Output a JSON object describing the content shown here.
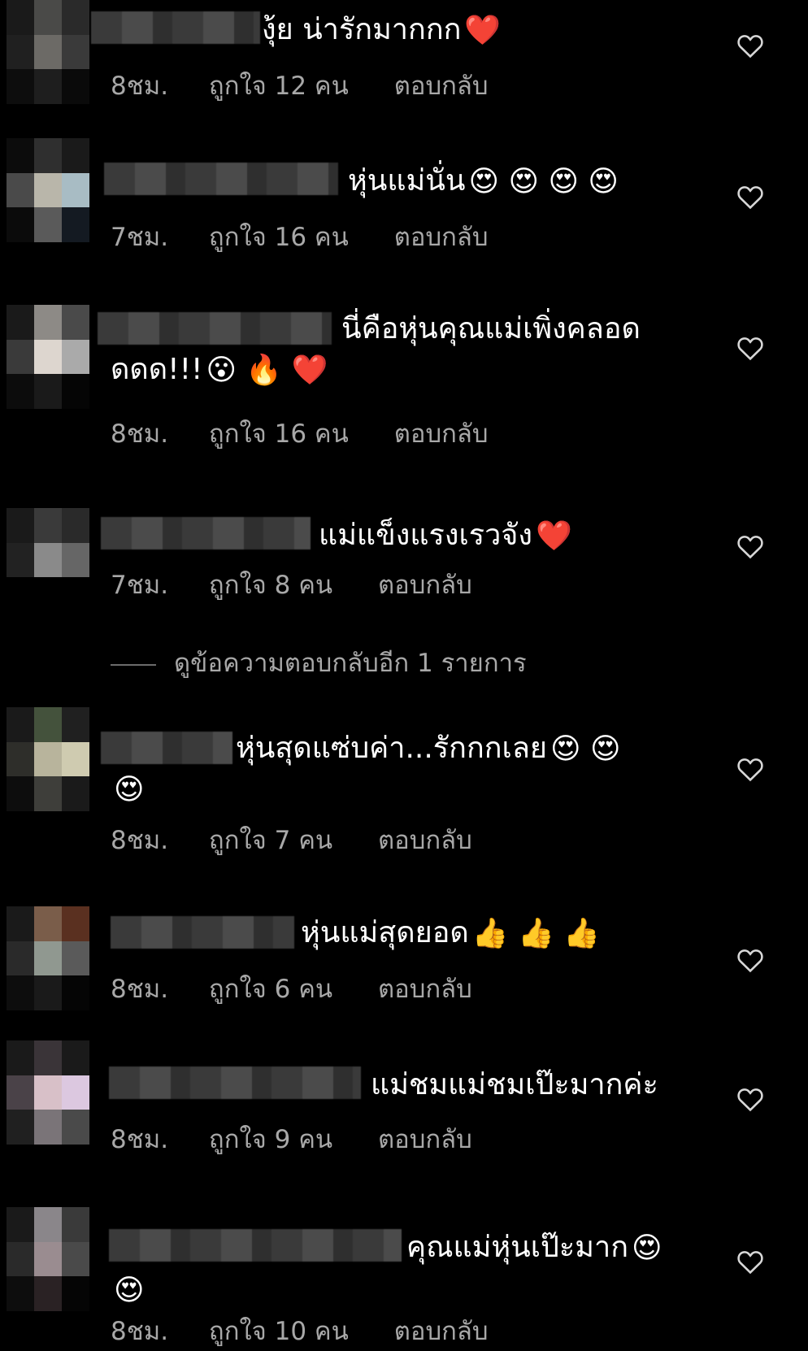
{
  "comments": [
    {
      "text": "งุ้ย น่ารักมากกก",
      "emoji": "❤️",
      "time": "8ชม.",
      "likes": "ถูกใจ 12 คน",
      "reply": "ตอบกลับ"
    },
    {
      "text": "หุ่นแม่นั่น",
      "emoji": "😍 😍 😍 😍",
      "time": "7ชม.",
      "likes": "ถูกใจ 16 คน",
      "reply": "ตอบกลับ"
    },
    {
      "text": "นี่คือหุ่นคุณแม่เพิ่งคลอด",
      "text2": "ดดด!!!",
      "emoji": "😮 🔥 ❤️",
      "time": "8ชม.",
      "likes": "ถูกใจ 16 คน",
      "reply": "ตอบกลับ"
    },
    {
      "text": "แม่แข็งแรงเรวจัง",
      "emoji": "❤️",
      "time": "7ชม.",
      "likes": "ถูกใจ 8 คน",
      "reply": "ตอบกลับ"
    },
    {
      "text": "หุ่นสุดแซ่บค่า...รักกกเลย",
      "emoji": "😍 😍",
      "emoji2": "😍",
      "time": "8ชม.",
      "likes": "ถูกใจ 7 คน",
      "reply": "ตอบกลับ"
    },
    {
      "text": "หุ่นแม่สุดยอด",
      "emoji": "👍 👍 👍",
      "time": "8ชม.",
      "likes": "ถูกใจ 6 คน",
      "reply": "ตอบกลับ"
    },
    {
      "text": "แม่ชมแม่ชมเป๊ะมากค่ะ",
      "emoji": "",
      "time": "8ชม.",
      "likes": "ถูกใจ 9 คน",
      "reply": "ตอบกลับ"
    },
    {
      "text": "คุณแม่หุ่นเป๊ะมาก",
      "emoji": "😍",
      "emoji2": "😍",
      "time": "8ชม.",
      "likes": "ถูกใจ 10 คน",
      "reply": "ตอบกลับ"
    }
  ],
  "view_more_replies": "ดูข้อความตอบกลับอีก 1 รายการ",
  "icons": {
    "like": "heart-outline-icon"
  },
  "colors": {
    "background": "#000000",
    "text": "#ffffff",
    "meta": "#a8a8a8"
  }
}
